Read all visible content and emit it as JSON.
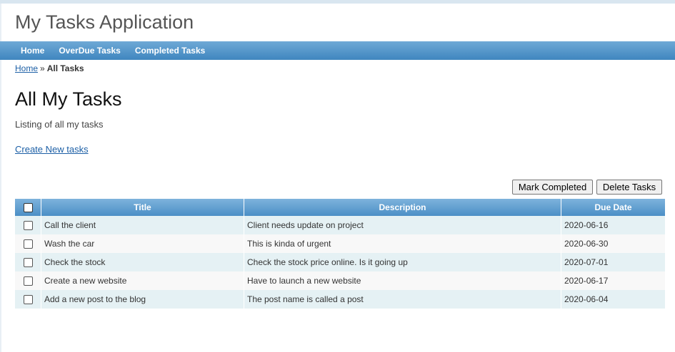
{
  "app": {
    "title": "My Tasks Application"
  },
  "nav": {
    "items": [
      {
        "label": "Home"
      },
      {
        "label": "OverDue Tasks"
      },
      {
        "label": "Completed Tasks"
      }
    ]
  },
  "breadcrumb": {
    "home": "Home",
    "separator": "»",
    "current": "All Tasks"
  },
  "page": {
    "title": "All My Tasks",
    "description": "Listing of all my tasks",
    "create_link": "Create New tasks"
  },
  "actions": {
    "mark_completed": "Mark Completed",
    "delete_tasks": "Delete Tasks"
  },
  "table": {
    "headers": {
      "title": "Title",
      "description": "Description",
      "due_date": "Due Date"
    },
    "rows": [
      {
        "title": "Call the client",
        "description": "Client needs update on project",
        "due_date": "2020-06-16"
      },
      {
        "title": "Wash the car",
        "description": "This is kinda of urgent",
        "due_date": "2020-06-30"
      },
      {
        "title": "Check the stock",
        "description": "Check the stock price online. Is it going up",
        "due_date": "2020-07-01"
      },
      {
        "title": "Create a new website",
        "description": "Have to launch a new website",
        "due_date": "2020-06-17"
      },
      {
        "title": "Add a new post to the blog",
        "description": "The post name is called a post",
        "due_date": "2020-06-04"
      }
    ]
  },
  "colors": {
    "nav_bar": "#4b8fc6",
    "link": "#1c5fa6",
    "row_alt": "#e5f1f4"
  }
}
